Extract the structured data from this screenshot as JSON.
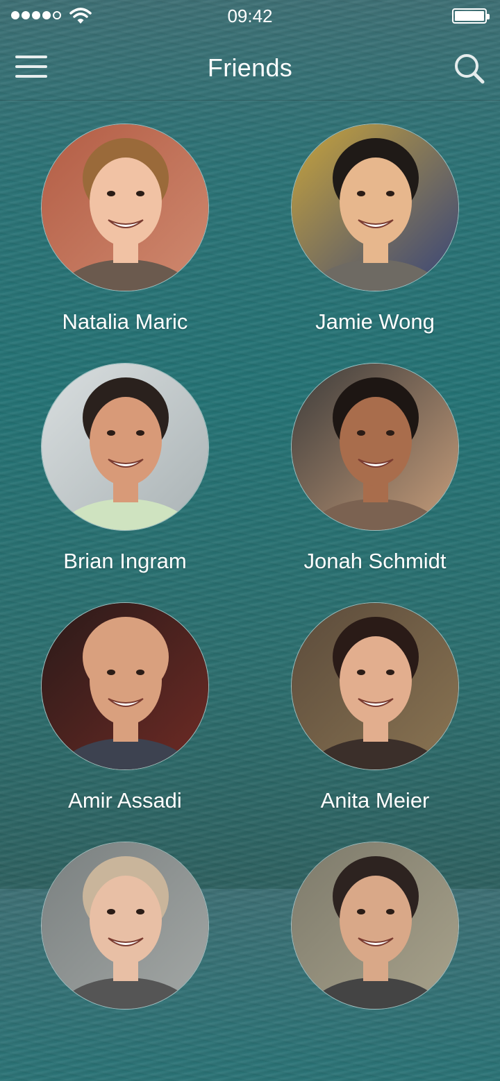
{
  "status_bar": {
    "time": "09:42",
    "signal_strength_of_5": 4,
    "battery_level_fraction": 1.0
  },
  "navbar": {
    "title": "Friends",
    "menu_icon": "hamburger-menu-icon",
    "search_icon": "magnifier-search-icon"
  },
  "friends": [
    {
      "name": "Natalia Maric",
      "photo": "portrait-woman-long-brown-hair-brick-wall",
      "skin": "#f1c2a4",
      "hair": "#9a6a3a",
      "bg1": "#b35d45",
      "bg2": "#d08a70",
      "shirt": "#6b5a4e"
    },
    {
      "name": "Jamie Wong",
      "photo": "portrait-man-short-black-hair-blue-background",
      "skin": "#e7b78d",
      "hair": "#1f1a17",
      "bg1": "#c8a43c",
      "bg2": "#33427a",
      "shirt": "#6e6a63"
    },
    {
      "name": "Brian Ingram",
      "photo": "portrait-man-short-dark-hair-light-background",
      "skin": "#d89a78",
      "hair": "#2a211d",
      "bg1": "#d9dedf",
      "bg2": "#a9b2b4",
      "shirt": "#cfe3c0"
    },
    {
      "name": "Jonah Schmidt",
      "photo": "portrait-man-beard-dark-shop-background",
      "skin": "#a96d4c",
      "hair": "#1d1613",
      "bg1": "#3c3b3a",
      "bg2": "#c99f7c",
      "shirt": "#7b6251"
    },
    {
      "name": "Amir Assadi",
      "photo": "portrait-bald-man-dark-red-background",
      "skin": "#d9a07e",
      "hair": "#d9a07e",
      "bg1": "#2a1a19",
      "bg2": "#6f2b25",
      "shirt": "#3d4250"
    },
    {
      "name": "Anita Meier",
      "photo": "portrait-woman-dark-curly-hair",
      "skin": "#e2ae8e",
      "hair": "#2a1b17",
      "bg1": "#5b4b3b",
      "bg2": "#8b7553",
      "shirt": "#3b2f2a"
    },
    {
      "name": "",
      "photo": "portrait-partially-visible-light-hair",
      "skin": "#e8bfa5",
      "hair": "#c9b59b",
      "bg1": "#7a8080",
      "bg2": "#a4a8a6",
      "shirt": "#555"
    },
    {
      "name": "",
      "photo": "portrait-partially-visible-dark-hair",
      "skin": "#d9a888",
      "hair": "#2d2320",
      "bg1": "#7d7a6b",
      "bg2": "#a9a38c",
      "shirt": "#444"
    }
  ]
}
